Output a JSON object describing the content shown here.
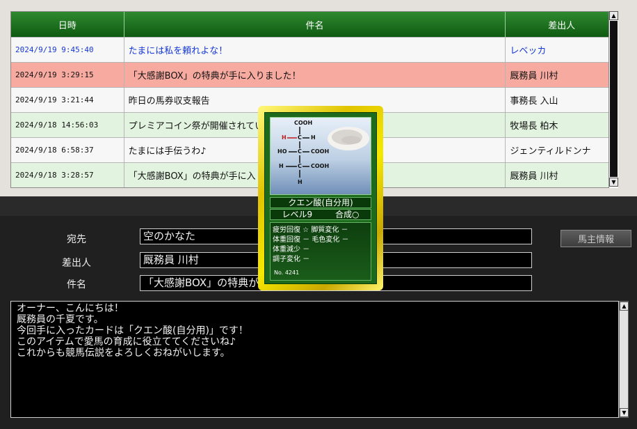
{
  "table": {
    "headers": {
      "date": "日時",
      "subject": "件名",
      "from": "差出人"
    },
    "rows": [
      {
        "date": "2024/9/19 9:45:40",
        "subject": "たまには私を頼れよな！",
        "from": "レベッカ"
      },
      {
        "date": "2024/9/19 3:29:15",
        "subject": "「大感謝BOX」の特典が手に入りました！",
        "from": "厩務員 川村"
      },
      {
        "date": "2024/9/19 3:21:44",
        "subject": "昨日の馬券収支報告",
        "from": "事務長 入山"
      },
      {
        "date": "2024/9/18 14:56:03",
        "subject": "プレミアコイン祭が開催されてい",
        "from": "牧場長 柏木"
      },
      {
        "date": "2024/9/18 6:58:37",
        "subject": "たまには手伝うわ♪",
        "from": "ジェンティルドンナ"
      },
      {
        "date": "2024/9/18 3:28:57",
        "subject": "「大感謝BOX」の特典が手に入",
        "from": "厩務員 川村"
      }
    ]
  },
  "detail": {
    "to_label": "宛先",
    "to_value": "空のかなた",
    "from_label": "差出人",
    "from_value": "厩務員 川村",
    "subject_label": "件名",
    "subject_value": "「大感謝BOX」の特典が手に入りました！",
    "owner_button": "馬主情報",
    "body_lines": [
      "オーナー、こんにちは！",
      "厩務員の千夏です。",
      "",
      "今回手に入ったカードは「クエン酸(自分用)」です！",
      "",
      "このアイテムで愛馬の育成に役立ててくださいね♪",
      "これからも競馬伝説をよろしくおねがいします。"
    ]
  },
  "card": {
    "name": "クエン酸(自分用)",
    "level": "レベル9",
    "synth": "合成○",
    "effects": [
      "疲労回復 ☆ 脚質変化 －",
      "体重回復 － 毛色変化 －",
      "体重減少 －",
      "調子変化 －"
    ],
    "number": "No. 4241",
    "formula": {
      "cooh_top": "COOH",
      "h_left": "H",
      "c": "C",
      "h_right": "H",
      "ho": "HO",
      "cooh_mid": "COOH",
      "h_low": "H",
      "cooh_low": "COOH",
      "h_bottom": "H"
    }
  },
  "icons": {
    "scroll_up": "▲",
    "scroll_down": "▼"
  }
}
